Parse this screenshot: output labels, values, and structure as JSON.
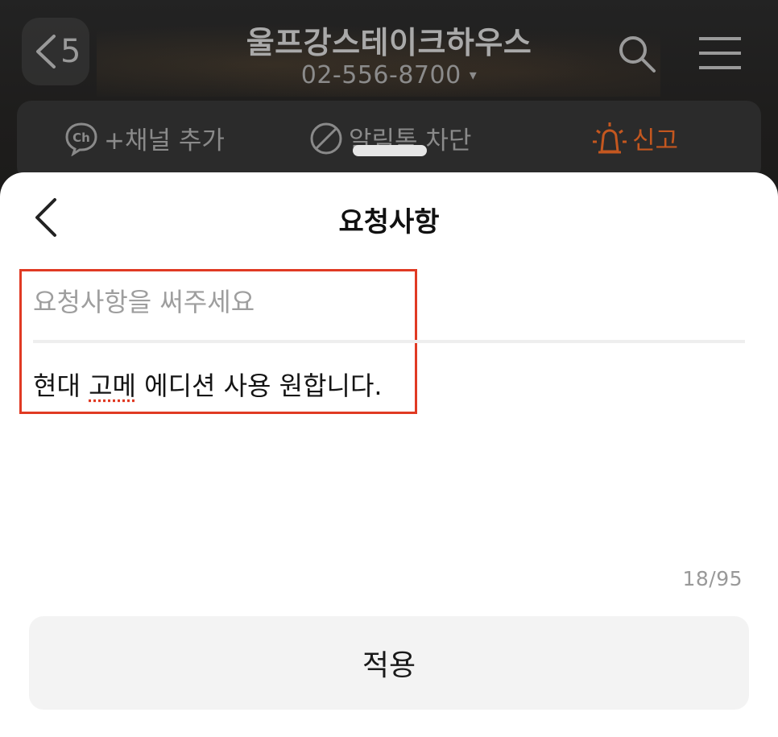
{
  "header": {
    "unread_count": "5",
    "title": "울프강스테이크하우스",
    "phone": "02-556-8700",
    "caret": "▾"
  },
  "actions": {
    "add_channel": "+채널 추가",
    "block_alimtalk": "알림톡 차단",
    "report": "신고"
  },
  "sheet": {
    "title": "요청사항",
    "input_placeholder": "요청사항을 써주세요",
    "input_value_before": "현대 ",
    "input_value_misspelled": "고메",
    "input_value_after": " 에디션 사용 원합니다.",
    "char_count": "18/95",
    "apply_label": "적용"
  },
  "colors": {
    "report_accent": "#c4571f",
    "highlight_border": "#e03a23",
    "sheet_bg": "#ffffff",
    "button_bg": "#f3f3f3"
  },
  "icons": [
    "back-chevron-icon",
    "search-icon",
    "hamburger-menu-icon",
    "channel-ch-icon",
    "block-icon",
    "siren-icon"
  ]
}
